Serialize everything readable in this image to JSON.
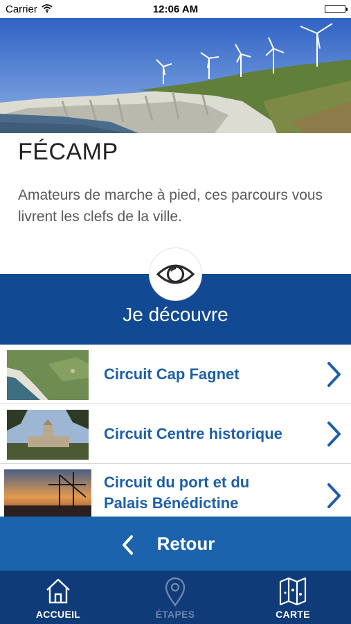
{
  "status_bar": {
    "carrier": "Carrier",
    "time": "12:06 AM"
  },
  "page": {
    "title": "FÉCAMP",
    "intro": "Amateurs de marche à pied, ces parcours vous livrent les clefs de la ville."
  },
  "discover": {
    "label": "Je découvre",
    "icon": "eye-icon"
  },
  "circuits": [
    {
      "label": "Circuit Cap Fagnet"
    },
    {
      "label": "Circuit Centre historique"
    },
    {
      "label_line1": "Circuit du port et du",
      "label_line2": "Palais Bénédictine"
    }
  ],
  "back_button": {
    "label": "Retour"
  },
  "tabbar": {
    "tabs": [
      {
        "label": "ACCUEIL",
        "icon": "home-icon"
      },
      {
        "label": "ÉTAPES",
        "icon": "map-pin-icon"
      },
      {
        "label": "CARTE",
        "icon": "folded-map-icon"
      }
    ]
  },
  "colors": {
    "primary_blue": "#124993",
    "link_blue": "#1d5fa8",
    "back_bar": "#1c63ad",
    "tab_bar": "#0f3b78",
    "tab_active": "#ffffff",
    "tab_inactive": "#6f86ab"
  }
}
